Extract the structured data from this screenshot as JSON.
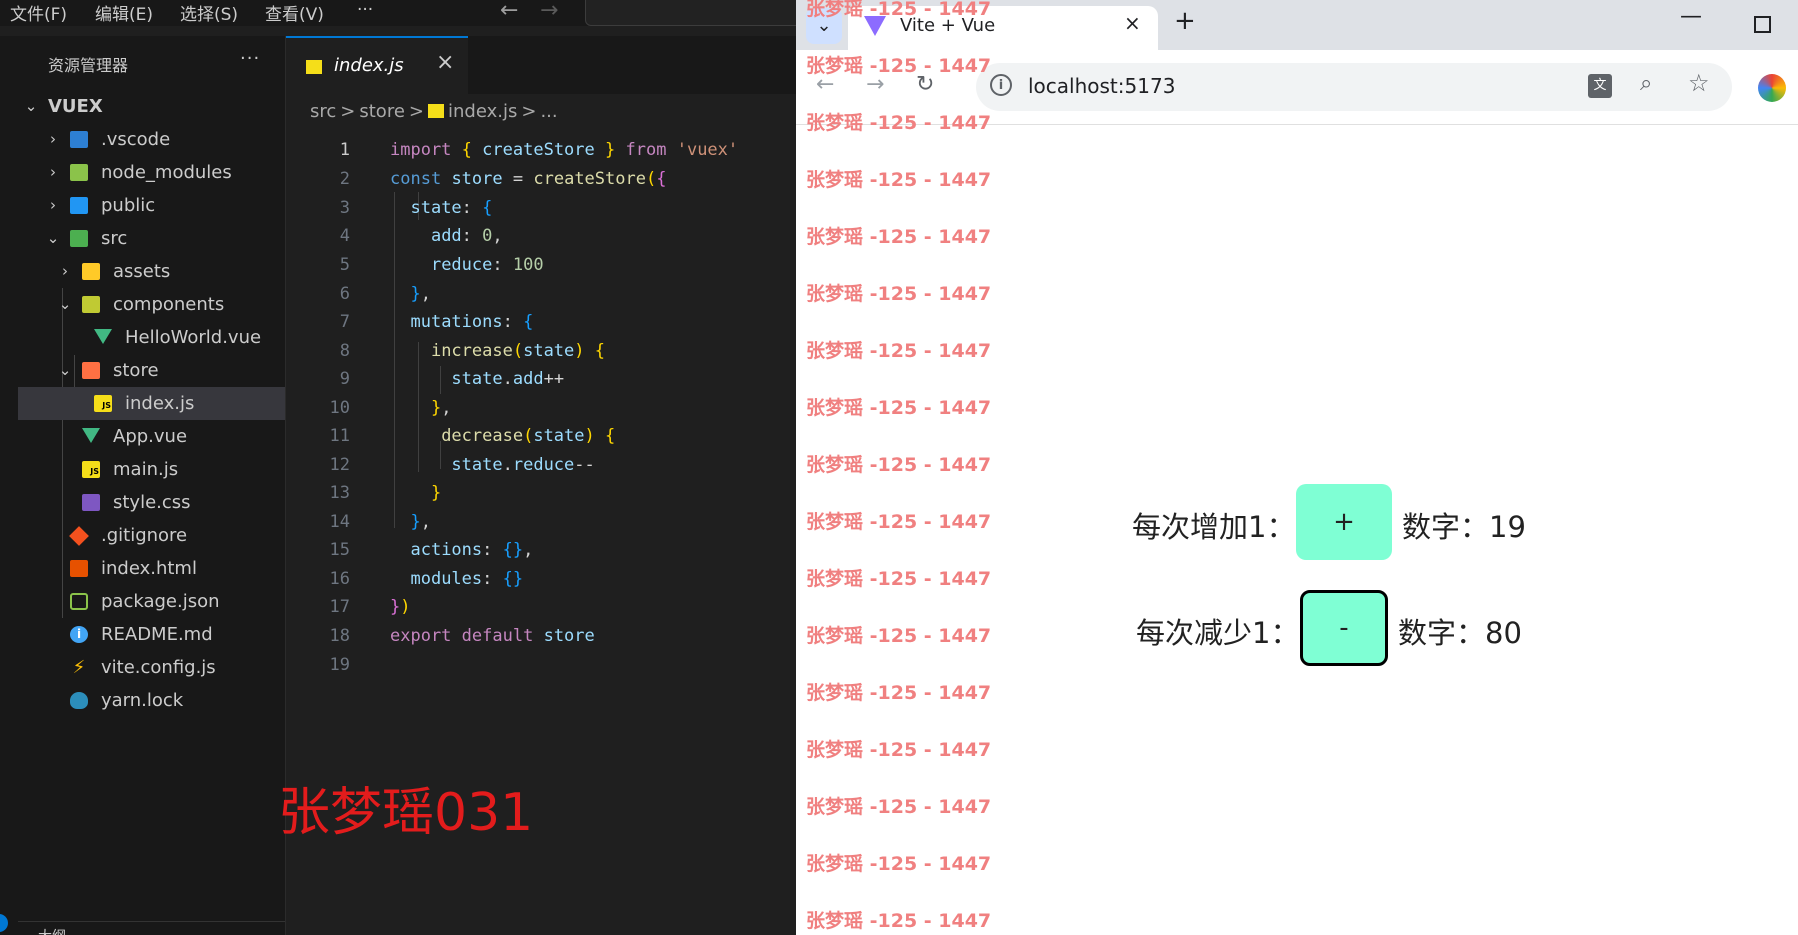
{
  "vscode": {
    "menu": [
      "文件(F)",
      "编辑(E)",
      "选择(S)",
      "查看(V)",
      "···"
    ],
    "explorer_title": "资源管理器",
    "explorer_more": "···",
    "root": "VUEX",
    "tree": [
      {
        "label": ".vscode",
        "icon": "vscode-folder-icon"
      },
      {
        "label": "node_modules",
        "icon": "node-folder-icon"
      },
      {
        "label": "public",
        "icon": "public-folder-icon"
      },
      {
        "label": "src",
        "icon": "src-folder-icon"
      },
      {
        "label": "assets",
        "icon": "assets-folder-icon"
      },
      {
        "label": "components",
        "icon": "components-folder-icon"
      },
      {
        "label": "HelloWorld.vue",
        "icon": "vue-file-icon"
      },
      {
        "label": "store",
        "icon": "store-folder-icon"
      },
      {
        "label": "index.js",
        "icon": "js-file-icon"
      },
      {
        "label": "App.vue",
        "icon": "vue-file-icon"
      },
      {
        "label": "main.js",
        "icon": "js-file-icon"
      },
      {
        "label": "style.css",
        "icon": "css-file-icon"
      },
      {
        "label": ".gitignore",
        "icon": "git-file-icon"
      },
      {
        "label": "index.html",
        "icon": "html-file-icon"
      },
      {
        "label": "package.json",
        "icon": "json-file-icon"
      },
      {
        "label": "README.md",
        "icon": "readme-file-icon"
      },
      {
        "label": "vite.config.js",
        "icon": "vite-file-icon"
      },
      {
        "label": "yarn.lock",
        "icon": "yarn-file-icon"
      }
    ],
    "outline_label": "大纲",
    "tab_label": "index.js",
    "breadcrumb": [
      "src",
      ">",
      "store",
      ">",
      "index.js",
      ">",
      "..."
    ],
    "line_numbers": [
      "1",
      "2",
      "3",
      "4",
      "5",
      "6",
      "7",
      "8",
      "9",
      "10",
      "11",
      "12",
      "13",
      "14",
      "15",
      "16",
      "17",
      "18",
      "19"
    ],
    "overlay_text": "张梦瑶031",
    "colors": {
      "accent": "#0078d4",
      "selection": "#37373d",
      "overlay": "#e31c1c"
    }
  },
  "browser": {
    "tab_title": "Vite + Vue",
    "url": "localhost:5173",
    "watermark": "张梦瑶 -125 - 1447",
    "increase_label": "每次增加1：",
    "increase_button": "+",
    "increase_value_label": "数字：19",
    "decrease_label": "每次减少1：",
    "decrease_button": "-",
    "decrease_value_label": "数字：80",
    "colors": {
      "button": "#7fffd4",
      "watermark": "#f08080"
    }
  }
}
